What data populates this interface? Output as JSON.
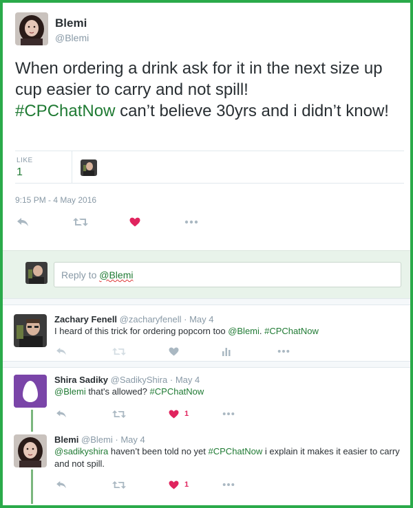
{
  "tweet": {
    "author_name": "Blemi",
    "author_handle": "@Blemi",
    "text_before": "When ordering a drink ask for it in the next size up cup easier to carry and not spill!",
    "hashtag": "#CPChatNow",
    "text_after": " can’t believe 30yrs and i didn’t know!",
    "like_label": "LIKE",
    "like_count": "1",
    "timestamp": "9:15 PM - 4 May 2016",
    "liked": true
  },
  "reply_box": {
    "prefix": "Reply to ",
    "mention": "@Blemi"
  },
  "replies": [
    {
      "name": "Zachary Fenell",
      "handle": "@zacharyfenell",
      "date": "May 4",
      "text_1": "I heard of this trick for ordering popcorn too ",
      "mention": "@Blemi",
      "text_2": ". ",
      "hashtag": "#CPChatNow",
      "like_count": ""
    },
    {
      "name": "Shira Sadiky",
      "handle": "@SadikyShira",
      "date": "May 4",
      "mention": "@Blemi",
      "text_1": " that's allowed? ",
      "hashtag": "#CPChatNow",
      "like_count": "1"
    },
    {
      "name": "Blemi",
      "handle": "@Blemi",
      "date": "May 4",
      "mention": "@sadikyshira",
      "text_1": " haven’t been told no yet ",
      "hashtag": "#CPChatNow",
      "text_2": " i explain it makes it easier to carry and not spill.",
      "like_count": "1"
    }
  ],
  "icons": [
    "reply-icon",
    "retweet-icon",
    "heart-icon",
    "more-icon",
    "analytics-icon",
    "egg-avatar-icon"
  ],
  "colors": {
    "frame": "#2aaa4a",
    "hashtag": "#1f7a33",
    "heart_active": "#e0245e",
    "icon_gray": "#aab8c2",
    "reply_box_bg": "#e8f3ea",
    "egg_purple": "#7a45a8"
  }
}
